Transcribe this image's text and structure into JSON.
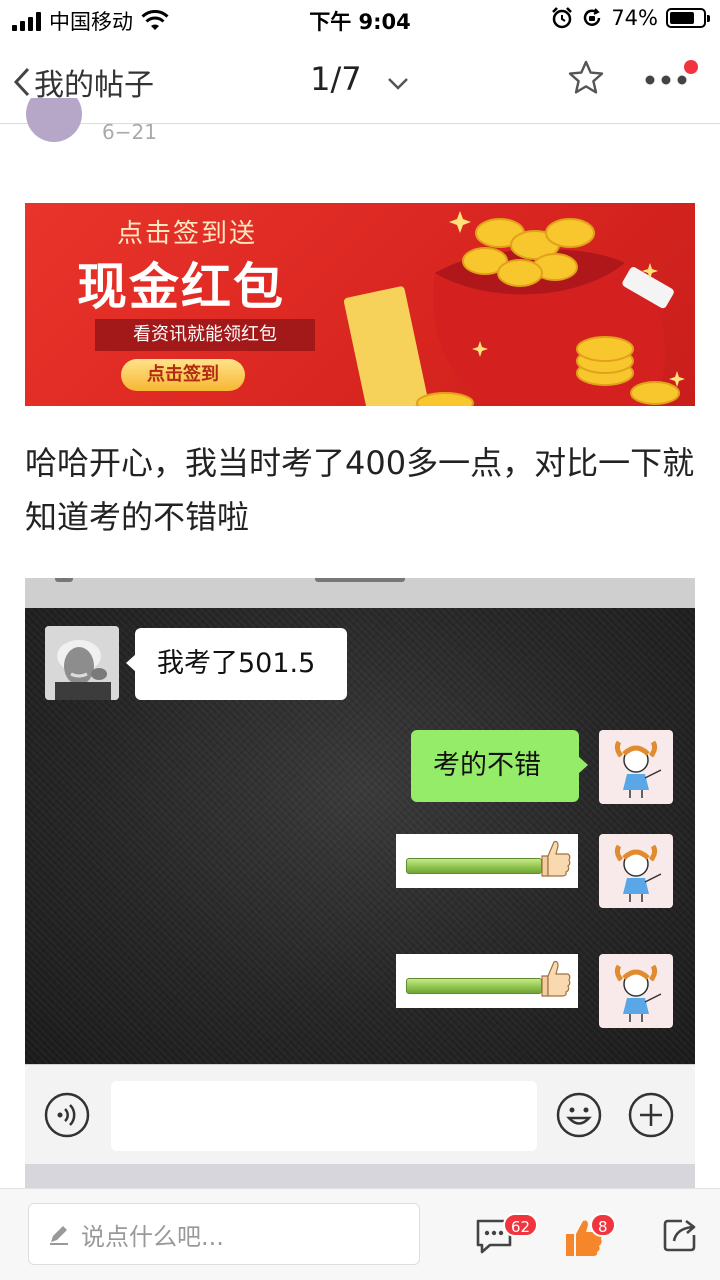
{
  "status_bar": {
    "carrier": "中国移动",
    "time": "下午 9:04",
    "battery": "74%",
    "battery_level": 0.74
  },
  "nav": {
    "back_label": "我的帖子",
    "page_indicator": "1/7",
    "has_unread_dot": true
  },
  "post": {
    "date": "6−21",
    "body": "哈哈开心，我当时考了400多一点，对比一下就知道考的不错啦"
  },
  "banner": {
    "subtitle": "点击签到送",
    "title": "现金红包",
    "ribbon": "看资讯就能领红包",
    "button": "点击签到"
  },
  "chat_image": {
    "messages": [
      {
        "side": "left",
        "type": "text",
        "text": "我考了501.5"
      },
      {
        "side": "right",
        "type": "text",
        "text": "考的不错"
      },
      {
        "side": "right",
        "type": "sticker",
        "sticker": "thumbs-up-bar"
      },
      {
        "side": "right",
        "type": "sticker",
        "sticker": "thumbs-up-bar"
      }
    ]
  },
  "bottom_bar": {
    "comment_placeholder": "说点什么吧...",
    "comment_count": "62",
    "like_count": "8"
  },
  "colors": {
    "brand_red": "#f0353f",
    "like_orange": "#f5872a",
    "wechat_green": "#95ec69",
    "banner_red": "#e0302a"
  }
}
